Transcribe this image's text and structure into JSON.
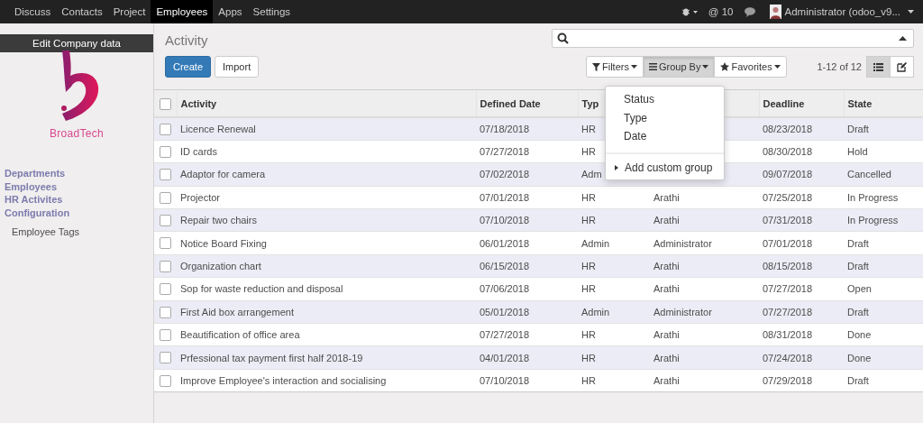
{
  "top_menu": [
    {
      "label": "Discuss",
      "selected": false
    },
    {
      "label": "Contacts",
      "selected": false
    },
    {
      "label": "Project",
      "selected": false
    },
    {
      "label": "Employees",
      "selected": true
    },
    {
      "label": "Apps",
      "selected": false
    },
    {
      "label": "Settings",
      "selected": false
    }
  ],
  "systray": {
    "mentions": "@ 10",
    "user": "Administrator (odoo_v9..."
  },
  "sidebar": {
    "edit_button": "Edit Company data",
    "logo_text": "BroadTech",
    "menu": [
      {
        "label": "Departments",
        "kind": "section"
      },
      {
        "label": "Employees",
        "kind": "section"
      },
      {
        "label": "HR Activites",
        "kind": "section"
      },
      {
        "label": "Configuration",
        "kind": "section"
      },
      {
        "label": "Employee Tags",
        "kind": "item"
      }
    ]
  },
  "breadcrumb": "Activity",
  "buttons": {
    "create": "Create",
    "import": "Import"
  },
  "search_options": [
    {
      "label": "Filters",
      "kind": "filter",
      "selected": false
    },
    {
      "label": "Group By",
      "kind": "group",
      "selected": true
    },
    {
      "label": "Favorites",
      "kind": "favorite",
      "selected": false
    }
  ],
  "pager": "1-12 of 12",
  "views": [
    {
      "kind": "list",
      "selected": true
    },
    {
      "kind": "form",
      "selected": false
    }
  ],
  "group_by_menu": {
    "options": [
      "Status",
      "Type",
      "Date"
    ],
    "custom": "Add custom group"
  },
  "table": {
    "all_checked": false,
    "columns": [
      {
        "label": "Activity"
      },
      {
        "label": "Defined Date"
      },
      {
        "label": "Typ"
      },
      {},
      {
        "label": "Deadline"
      },
      {
        "label": "State"
      }
    ],
    "rows": [
      {
        "checked": false,
        "cells": [
          "Licence Renewal",
          "07/18/2018",
          "HR",
          null,
          "08/23/2018",
          "Draft"
        ]
      },
      {
        "checked": false,
        "cells": [
          "ID cards",
          "07/27/2018",
          "HR",
          null,
          "08/30/2018",
          "Hold"
        ]
      },
      {
        "checked": false,
        "cells": [
          "Adaptor for camera",
          "07/02/2018",
          "Adm",
          null,
          "09/07/2018",
          "Cancelled"
        ]
      },
      {
        "checked": false,
        "cells": [
          "Projector",
          "07/01/2018",
          "HR",
          "Arathi",
          "07/25/2018",
          "In Progress"
        ]
      },
      {
        "checked": false,
        "cells": [
          "Repair two chairs",
          "07/10/2018",
          "HR",
          "Arathi",
          "07/31/2018",
          "In Progress"
        ]
      },
      {
        "checked": false,
        "cells": [
          "Notice Board Fixing",
          "06/01/2018",
          "Admin",
          "Administrator",
          "07/01/2018",
          "Draft"
        ]
      },
      {
        "checked": false,
        "cells": [
          "Organization chart",
          "06/15/2018",
          "HR",
          "Arathi",
          "08/15/2018",
          "Draft"
        ]
      },
      {
        "checked": false,
        "cells": [
          "Sop for waste reduction and disposal",
          "07/06/2018",
          "HR",
          "Arathi",
          "07/27/2018",
          "Open"
        ]
      },
      {
        "checked": false,
        "cells": [
          "First Aid box arrangement",
          "05/01/2018",
          "Admin",
          "Administrator",
          "07/27/2018",
          "Draft"
        ]
      },
      {
        "checked": false,
        "cells": [
          "Beautification of office area",
          "07/27/2018",
          "HR",
          "Arathi",
          "08/31/2018",
          "Done"
        ]
      },
      {
        "checked": false,
        "cells": [
          "Prfessional tax payment first half 2018-19",
          "04/01/2018",
          "HR",
          "Arathi",
          "07/24/2018",
          "Done"
        ]
      },
      {
        "checked": false,
        "cells": [
          "Improve Employee's interaction and socialising",
          "07/10/2018",
          "HR",
          "Arathi",
          "07/29/2018",
          "Draft"
        ]
      }
    ]
  }
}
